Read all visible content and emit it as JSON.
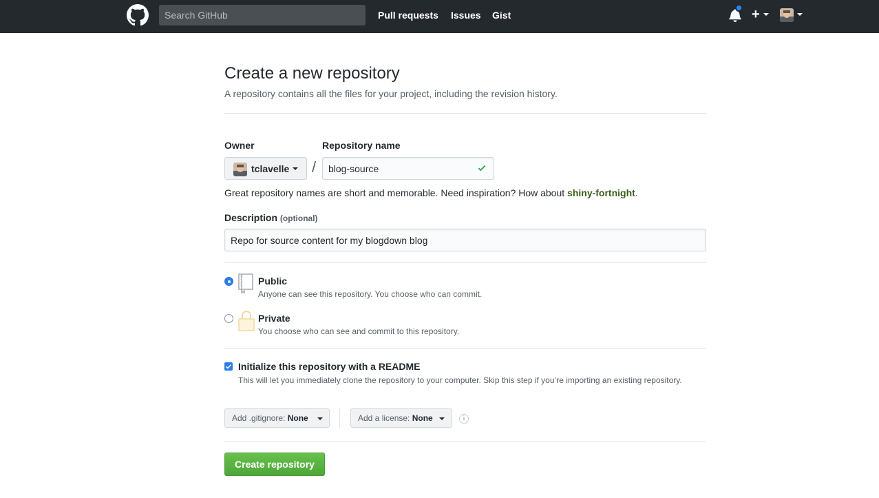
{
  "header": {
    "search_placeholder": "Search GitHub",
    "nav": [
      "Pull requests",
      "Issues",
      "Gist"
    ],
    "new_label": "+"
  },
  "page": {
    "title": "Create a new repository",
    "subtitle": "A repository contains all the files for your project, including the revision history."
  },
  "form": {
    "owner_label": "Owner",
    "owner_value": "tclavelle",
    "separator": "/",
    "repo_label": "Repository name",
    "repo_value": "blog-source",
    "hint_text": "Great repository names are short and memorable. Need inspiration? How about ",
    "hint_suggestion": "shiny-fortnight",
    "hint_end": ".",
    "description_label": "Description",
    "description_optional": "(optional)",
    "description_value": "Repo for source content for my blogdown blog",
    "visibility": [
      {
        "title": "Public",
        "desc": "Anyone can see this repository. You choose who can commit.",
        "selected": true
      },
      {
        "title": "Private",
        "desc": "You choose who can see and commit to this repository.",
        "selected": false
      }
    ],
    "readme_title": "Initialize this repository with a README",
    "readme_desc": "This will let you immediately clone the repository to your computer. Skip this step if you’re importing an existing repository.",
    "readme_checked": true,
    "gitignore_prefix": "Add .gitignore: ",
    "gitignore_value": "None",
    "license_prefix": "Add a license: ",
    "license_value": "None",
    "info_glyph": "i",
    "create_label": "Create repository"
  },
  "colors": {
    "header_bg": "#24292e",
    "accent_blue": "#2b7de9",
    "create_green": "#55ad40",
    "suggestion_green": "#3a5e1c",
    "check_green": "#28a745"
  },
  "icons": [
    "github-logo-icon",
    "bell-icon",
    "plus-icon",
    "avatar",
    "checkmark-icon",
    "repo-book-icon",
    "lock-icon",
    "info-icon"
  ]
}
